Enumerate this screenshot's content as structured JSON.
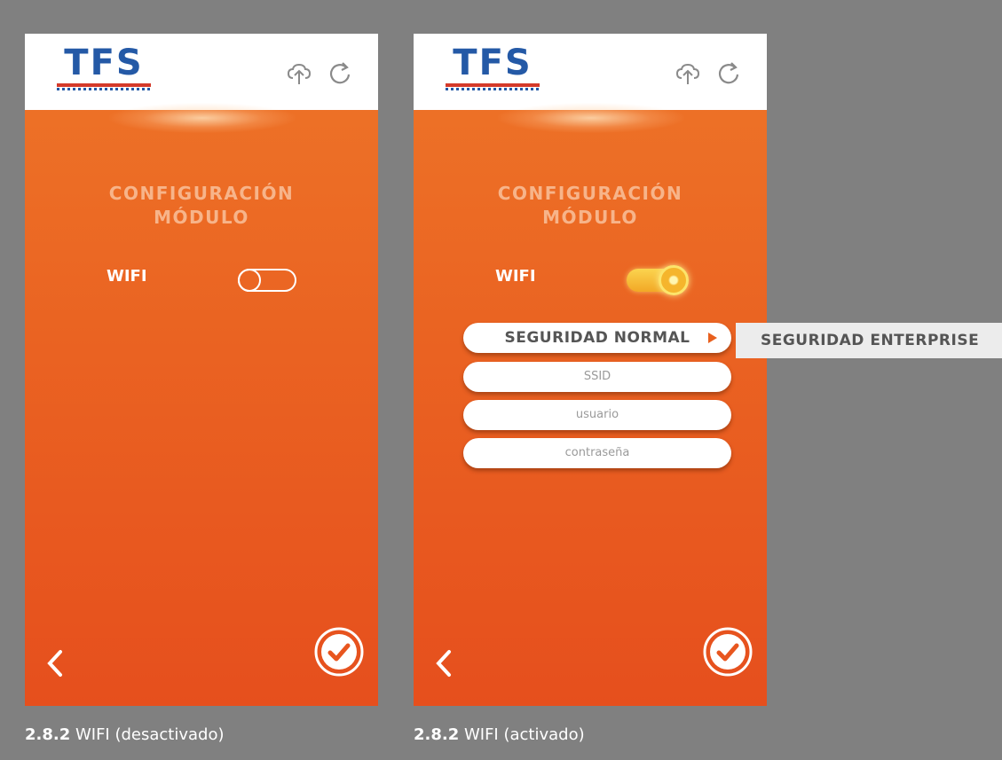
{
  "brand": {
    "logo_text": "TFS"
  },
  "screens": [
    {
      "title_line1": "CONFIGURACIÓN",
      "title_line2": "MÓDULO",
      "wifi_label": "WIFI",
      "wifi_enabled": false,
      "caption_number": "2.8.2",
      "caption_text": " WIFI (desactivado)"
    },
    {
      "title_line1": "CONFIGURACIÓN",
      "title_line2": "MÓDULO",
      "wifi_label": "WIFI",
      "wifi_enabled": true,
      "security_selected": "SEGURIDAD NORMAL",
      "ssid_placeholder": "SSID",
      "user_placeholder": "usuario",
      "password_placeholder": "contraseña",
      "caption_number": "2.8.2",
      "caption_text": " WIFI (activado)"
    }
  ],
  "security_alternative": "SEGURIDAD ENTERPRISE",
  "icons": [
    "cloud-upload-icon",
    "refresh-icon",
    "chevron-left-icon",
    "check-circle-icon",
    "triangle-right-icon"
  ],
  "colors": {
    "background": "#808080",
    "screen_orange": "#e8561f",
    "header": "#ffffff",
    "logo_blue": "#2459a6",
    "logo_red": "#d43a2a",
    "title_peach": "#f7b48a",
    "toggle_on": "#f5b52c"
  }
}
